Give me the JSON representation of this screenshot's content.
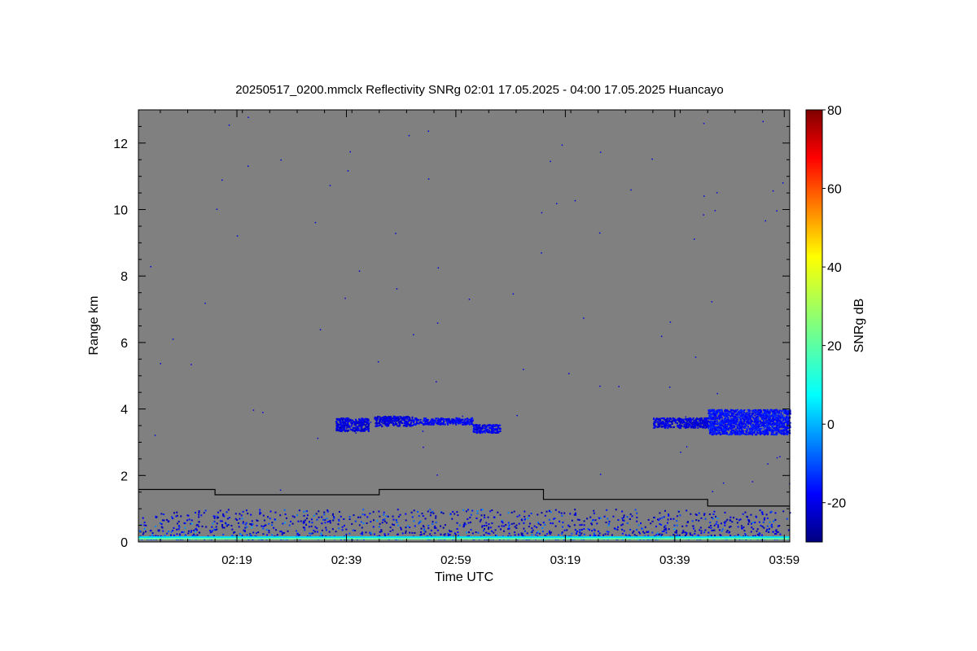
{
  "chart_data": {
    "type": "heatmap",
    "title": "20250517_0200.mmclx Reflectivity SNRg   02:01 17.05.2025 - 04:00 17.05.2025 Huancayo",
    "xlabel": "Time UTC",
    "ylabel": "Range km",
    "colorbar_label": "SNRg dB",
    "xlim_minutes": [
      121,
      240
    ],
    "x_ticks": [
      {
        "label": "02:19",
        "minutes": 139
      },
      {
        "label": "02:39",
        "minutes": 159
      },
      {
        "label": "02:59",
        "minutes": 179
      },
      {
        "label": "03:19",
        "minutes": 199
      },
      {
        "label": "03:39",
        "minutes": 219
      },
      {
        "label": "03:59",
        "minutes": 239
      }
    ],
    "ylim": [
      0,
      13
    ],
    "y_ticks": [
      0,
      2,
      4,
      6,
      8,
      10,
      12
    ],
    "clim": [
      -30,
      80
    ],
    "colorbar_ticks": [
      -20,
      0,
      20,
      40,
      60,
      80
    ],
    "background_color": "#808080",
    "boundary_line": {
      "color": "#000000",
      "steps": [
        {
          "minutes_start": 121,
          "minutes_end": 135,
          "range_km": 1.58
        },
        {
          "minutes_start": 135,
          "minutes_end": 165,
          "range_km": 1.42
        },
        {
          "minutes_start": 165,
          "minutes_end": 195,
          "range_km": 1.58
        },
        {
          "minutes_start": 195,
          "minutes_end": 225,
          "range_km": 1.28
        },
        {
          "minutes_start": 225,
          "minutes_end": 240,
          "range_km": 1.08
        }
      ]
    },
    "cloud_layers": [
      {
        "minutes_start": 157,
        "minutes_end": 163,
        "range_bottom_km": 3.35,
        "range_top_km": 3.75,
        "snr_db": -20
      },
      {
        "minutes_start": 164,
        "minutes_end": 171,
        "range_bottom_km": 3.5,
        "range_top_km": 3.8,
        "snr_db": -20
      },
      {
        "minutes_start": 171,
        "minutes_end": 182,
        "range_bottom_km": 3.55,
        "range_top_km": 3.75,
        "snr_db": -17
      },
      {
        "minutes_start": 182,
        "minutes_end": 187,
        "range_bottom_km": 3.3,
        "range_top_km": 3.55,
        "snr_db": -18
      },
      {
        "minutes_start": 215,
        "minutes_end": 225,
        "range_bottom_km": 3.45,
        "range_top_km": 3.75,
        "snr_db": -20
      },
      {
        "minutes_start": 225,
        "minutes_end": 240,
        "range_bottom_km": 3.25,
        "range_top_km": 4.0,
        "snr_db": -15
      }
    ],
    "surface_clutter": {
      "range_bottom_km": 0.1,
      "range_top_km": 1.0,
      "snr_db_min": -25,
      "snr_db_max": 5
    }
  }
}
